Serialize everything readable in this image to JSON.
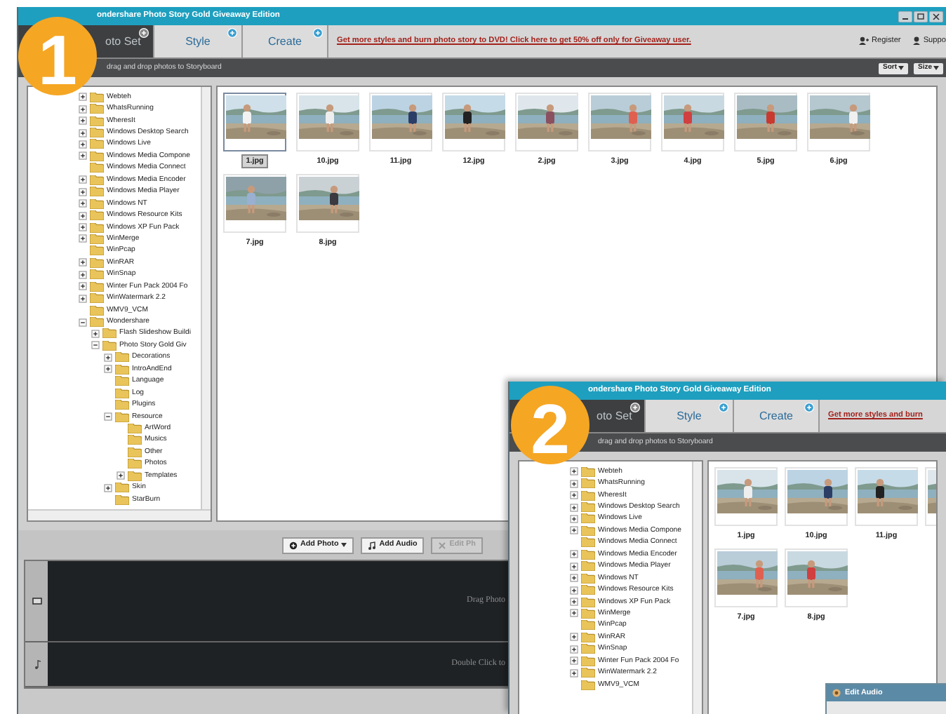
{
  "screenshots": [
    {
      "badge": "1",
      "title": "ondershare Photo Story Gold Giveaway Edition",
      "tabs": [
        {
          "label": "oto Set",
          "selected": true
        },
        {
          "label": "Style",
          "selected": false
        },
        {
          "label": "Create",
          "selected": false
        }
      ],
      "promo_link": "Get more styles and burn photo story to DVD! Click here to get 50% off only for Giveaway user.",
      "top_links": [
        {
          "kind": "register",
          "label": "Register"
        },
        {
          "kind": "support",
          "label": "Suppo"
        }
      ],
      "hint": "drag and drop photos to Storyboard",
      "view_buttons": [
        "Sort",
        "Size"
      ],
      "tree": [
        {
          "label": "Webteh",
          "collapsible": true,
          "expanded": false
        },
        {
          "label": "WhatsRunning",
          "collapsible": true,
          "expanded": false
        },
        {
          "label": "WheresIt",
          "collapsible": true,
          "expanded": false
        },
        {
          "label": "Windows Desktop Search",
          "collapsible": true,
          "expanded": false
        },
        {
          "label": "Windows Live",
          "collapsible": true,
          "expanded": false
        },
        {
          "label": "Windows Media Compone",
          "collapsible": true,
          "expanded": false
        },
        {
          "label": "Windows Media Connect",
          "collapsible": false
        },
        {
          "label": "Windows Media Encoder",
          "collapsible": true,
          "expanded": false
        },
        {
          "label": "Windows Media Player",
          "collapsible": true,
          "expanded": false
        },
        {
          "label": "Windows NT",
          "collapsible": true,
          "expanded": false
        },
        {
          "label": "Windows Resource Kits",
          "collapsible": true,
          "expanded": false
        },
        {
          "label": "Windows XP Fun Pack",
          "collapsible": true,
          "expanded": false
        },
        {
          "label": "WinMerge",
          "collapsible": true,
          "expanded": false
        },
        {
          "label": "WinPcap",
          "collapsible": false
        },
        {
          "label": "WinRAR",
          "collapsible": true,
          "expanded": false
        },
        {
          "label": "WinSnap",
          "collapsible": true,
          "expanded": false
        },
        {
          "label": "Winter Fun Pack 2004 Fo",
          "collapsible": true,
          "expanded": false
        },
        {
          "label": "WinWatermark 2.2",
          "collapsible": true,
          "expanded": false
        },
        {
          "label": "WMV9_VCM",
          "collapsible": false
        },
        {
          "label": "Wondershare",
          "collapsible": true,
          "expanded": true,
          "children": [
            {
              "label": "Flash Slideshow Buildi",
              "collapsible": true,
              "expanded": false
            },
            {
              "label": "Photo Story Gold Giv",
              "collapsible": true,
              "expanded": true,
              "children": [
                {
                  "label": "Decorations",
                  "collapsible": true,
                  "expanded": false
                },
                {
                  "label": "IntroAndEnd",
                  "collapsible": true,
                  "expanded": false
                },
                {
                  "label": "Language",
                  "collapsible": false
                },
                {
                  "label": "Log",
                  "collapsible": false
                },
                {
                  "label": "Plugins",
                  "collapsible": false
                },
                {
                  "label": "Resource",
                  "collapsible": true,
                  "expanded": true,
                  "children": [
                    {
                      "label": "ArtWord",
                      "collapsible": false
                    },
                    {
                      "label": "Musics",
                      "collapsible": false
                    },
                    {
                      "label": "Other",
                      "collapsible": false
                    },
                    {
                      "label": "Photos",
                      "collapsible": false
                    },
                    {
                      "label": "Templates",
                      "collapsible": true,
                      "expanded": false
                    }
                  ]
                },
                {
                  "label": "Skin",
                  "collapsible": true,
                  "expanded": false
                },
                {
                  "label": "StarBurn",
                  "collapsible": false
                }
              ]
            }
          ]
        }
      ],
      "photos": [
        {
          "name": "1.jpg",
          "selected": true
        },
        {
          "name": "10.jpg",
          "selected": false
        },
        {
          "name": "11.jpg",
          "selected": false
        },
        {
          "name": "12.jpg",
          "selected": false
        },
        {
          "name": "2.jpg",
          "selected": false
        },
        {
          "name": "3.jpg",
          "selected": false
        },
        {
          "name": "4.jpg",
          "selected": false
        },
        {
          "name": "5.jpg",
          "selected": false
        },
        {
          "name": "6.jpg",
          "selected": false
        },
        {
          "name": "7.jpg",
          "selected": false
        },
        {
          "name": "8.jpg",
          "selected": false
        }
      ],
      "storyboard_buttons": [
        {
          "label": "Add Photo",
          "kind": "dropdown",
          "disabled": false
        },
        {
          "label": "Add Audio",
          "kind": "audio",
          "disabled": false
        },
        {
          "label": "Edit Ph",
          "kind": "edit",
          "disabled": true
        }
      ],
      "tracks": [
        {
          "hint": "Drag Photo"
        },
        {
          "kind": "audio",
          "hint": "Double Click to"
        }
      ]
    },
    {
      "badge": "2",
      "title": "ondershare Photo Story Gold Giveaway Edition",
      "tabs": [
        {
          "label": "oto Set",
          "selected": true
        },
        {
          "label": "Style",
          "selected": false
        },
        {
          "label": "Create",
          "selected": false
        }
      ],
      "promo_link": "Get more styles and burn",
      "hint": "drag and drop photos to Storyboard",
      "tree": [
        {
          "label": "Webteh",
          "collapsible": true,
          "expanded": false
        },
        {
          "label": "WhatsRunning",
          "collapsible": true,
          "expanded": false
        },
        {
          "label": "WheresIt",
          "collapsible": true,
          "expanded": false
        },
        {
          "label": "Windows Desktop Search",
          "collapsible": true,
          "expanded": false
        },
        {
          "label": "Windows Live",
          "collapsible": true,
          "expanded": false
        },
        {
          "label": "Windows Media Compone",
          "collapsible": true,
          "expanded": false
        },
        {
          "label": "Windows Media Connect",
          "collapsible": false
        },
        {
          "label": "Windows Media Encoder",
          "collapsible": true,
          "expanded": false
        },
        {
          "label": "Windows Media Player",
          "collapsible": true,
          "expanded": false
        },
        {
          "label": "Windows NT",
          "collapsible": true,
          "expanded": false
        },
        {
          "label": "Windows Resource Kits",
          "collapsible": true,
          "expanded": false
        },
        {
          "label": "Windows XP Fun Pack",
          "collapsible": true,
          "expanded": false
        },
        {
          "label": "WinMerge",
          "collapsible": true,
          "expanded": false
        },
        {
          "label": "WinPcap",
          "collapsible": false
        },
        {
          "label": "WinRAR",
          "collapsible": true,
          "expanded": false
        },
        {
          "label": "WinSnap",
          "collapsible": true,
          "expanded": false
        },
        {
          "label": "Winter Fun Pack 2004 Fo",
          "collapsible": true,
          "expanded": false
        },
        {
          "label": "WinWatermark 2.2",
          "collapsible": true,
          "expanded": false
        },
        {
          "label": "WMV9_VCM",
          "collapsible": false
        }
      ],
      "photos": [
        {
          "name": "1.jpg",
          "selected": false
        },
        {
          "name": "10.jpg",
          "selected": false
        },
        {
          "name": "11.jpg",
          "selected": false
        },
        {
          "selected": false
        },
        {
          "name": "7.jpg",
          "selected": false
        },
        {
          "name": "8.jpg",
          "selected": false
        }
      ],
      "dialog": {
        "title": "Edit Audio"
      }
    }
  ]
}
